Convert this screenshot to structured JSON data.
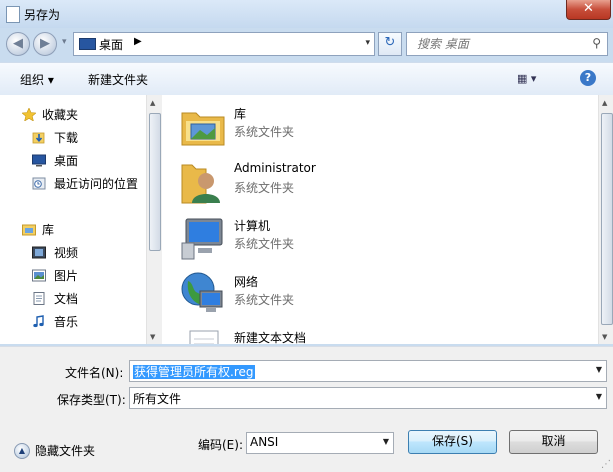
{
  "window": {
    "title": "另存为",
    "close_glyph": "✕"
  },
  "nav": {
    "back_glyph": "◀",
    "forward_glyph": "▶",
    "dropdown_glyph": "▾",
    "address": {
      "icon": "desktop-icon",
      "location": "桌面",
      "separator": "▶",
      "dropdown_glyph": "▾"
    },
    "refresh_glyph": "↻",
    "search": {
      "placeholder": "搜索 桌面",
      "icon": "search-icon",
      "icon_glyph": "⚲"
    }
  },
  "toolbar": {
    "organize_label": "组织 ▾",
    "new_folder_label": "新建文件夹",
    "view_glyph": "▦ ▾",
    "help_glyph": "?"
  },
  "sidebar": {
    "favorites": {
      "label": "收藏夹",
      "icon": "star-icon"
    },
    "favorites_items": [
      {
        "label": "下载",
        "icon": "download-folder-icon"
      },
      {
        "label": "桌面",
        "icon": "desktop-icon"
      },
      {
        "label": "最近访问的位置",
        "icon": "recent-places-icon"
      }
    ],
    "libraries": {
      "label": "库",
      "icon": "library-icon"
    },
    "library_items": [
      {
        "label": "视频",
        "icon": "video-icon"
      },
      {
        "label": "图片",
        "icon": "pictures-icon"
      },
      {
        "label": "文档",
        "icon": "documents-icon"
      },
      {
        "label": "音乐",
        "icon": "music-icon"
      }
    ]
  },
  "items": [
    {
      "name": "库",
      "type": "系统文件夹",
      "icon": "library-icon"
    },
    {
      "name": "Administrator",
      "type": "系统文件夹",
      "icon": "user-folder-icon"
    },
    {
      "name": "计算机",
      "type": "系统文件夹",
      "icon": "computer-icon"
    },
    {
      "name": "网络",
      "type": "系统文件夹",
      "icon": "network-icon"
    },
    {
      "name": "新建文本文档",
      "type": "",
      "icon": "text-document-icon"
    }
  ],
  "form": {
    "filename_label": "文件名(N):",
    "filename_value": "获得管理员所有权.reg",
    "filetype_label": "保存类型(T):",
    "filetype_value": "所有文件",
    "encoding_label": "编码(E):",
    "encoding_value": "ANSI",
    "dropdown_glyph": "▼"
  },
  "buttons": {
    "save": "保存(S)",
    "cancel": "取消"
  },
  "footer": {
    "hide_folders": "隐藏文件夹",
    "hide_folders_glyph": "▲"
  },
  "colors": {
    "accent": "#3399ff",
    "window_frame": "#c9dcef",
    "subtext": "#6d6d6d"
  }
}
